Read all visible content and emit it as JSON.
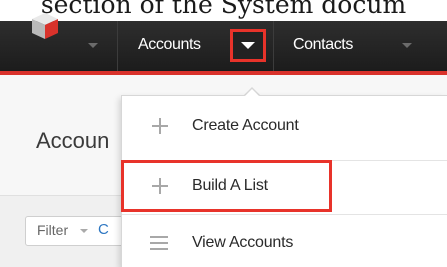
{
  "caption": {
    "text": "section of the System docum"
  },
  "navbar": {
    "logo_icon": "sugar-cube-icon",
    "accounts_label": "Accounts",
    "contacts_label": "Contacts",
    "highlight_color": "#e8332a",
    "accent_color": "#d9322b"
  },
  "page": {
    "title": "Accoun",
    "filter_label": "Filter",
    "filter_next_letter": "C"
  },
  "dropdown": {
    "items": [
      {
        "label": "Create Account",
        "icon": "plus-icon"
      },
      {
        "label": "Build A List",
        "icon": "plus-icon",
        "highlighted": true
      },
      {
        "label": "View Accounts",
        "icon": "list-icon"
      }
    ]
  }
}
